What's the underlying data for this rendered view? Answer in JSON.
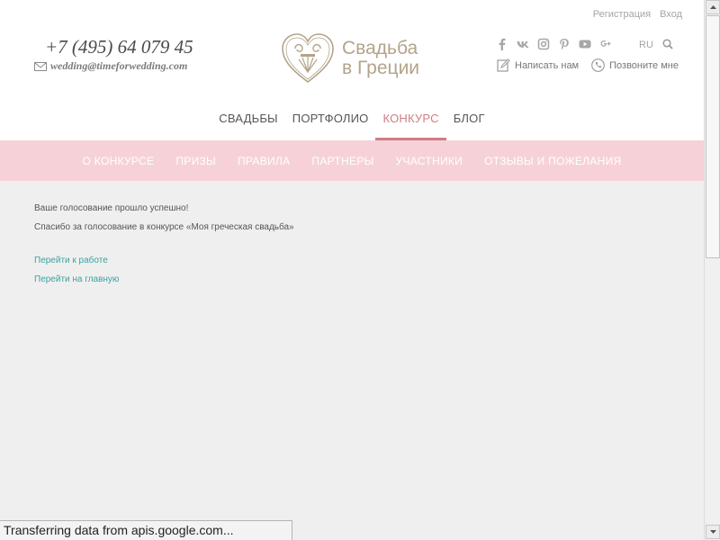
{
  "auth": {
    "register": "Регистрация",
    "login": "Вход"
  },
  "contact": {
    "phone": "+7 (495) 64 079 45",
    "email": "wedding@timeforwedding.com"
  },
  "logo": {
    "line1": "Свадьба",
    "line2": "в Греции"
  },
  "social_icons": [
    "facebook-icon",
    "vk-icon",
    "instagram-icon",
    "pinterest-icon",
    "youtube-icon",
    "google-plus-icon"
  ],
  "lang": "RU",
  "actions": {
    "write": "Написать нам",
    "call": "Позвоните мне"
  },
  "main_nav": [
    {
      "label": "СВАДЬБЫ",
      "active": false
    },
    {
      "label": "ПОРТФОЛИО",
      "active": false
    },
    {
      "label": "КОНКУРС",
      "active": true
    },
    {
      "label": "БЛОГ",
      "active": false
    }
  ],
  "sub_nav": [
    "О КОНКУРСЕ",
    "ПРИЗЫ",
    "ПРАВИЛА",
    "ПАРТНЕРЫ",
    "УЧАСТНИКИ",
    "ОТЗЫВЫ И ПОЖЕЛАНИЯ"
  ],
  "content": {
    "success": "Ваше голосование прошло успешно!",
    "thanks": "Спасибо за голосование в конкурсе «Моя греческая свадьба»",
    "link_work": "Перейти к работе",
    "link_home": "Перейти на главную"
  },
  "status": "Transferring data from apis.google.com...",
  "colors": {
    "accent": "#d07c86",
    "subnav_bg": "#f6d2d8",
    "link": "#3aa3a0",
    "logo": "#b3a48a"
  }
}
